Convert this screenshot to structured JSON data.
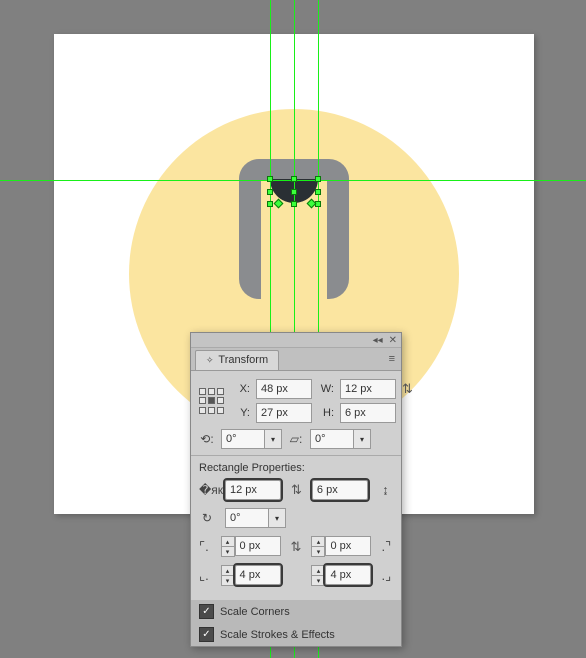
{
  "panel": {
    "tab": "Transform",
    "x_label": "X:",
    "y_label": "Y:",
    "w_label": "W:",
    "h_label": "H:",
    "x": "48 px",
    "y": "27 px",
    "w": "12 px",
    "h": "6 px",
    "rotate": "0°",
    "shear": "0°",
    "section": "Rectangle Properties:",
    "rect_w": "12 px",
    "rect_h": "6 px",
    "rect_rotate": "0°",
    "corner_tl": "0 px",
    "corner_tr": "0 px",
    "corner_bl": "4 px",
    "corner_br": "4 px",
    "scale_corners": "Scale Corners",
    "scale_strokes": "Scale Strokes & Effects"
  }
}
